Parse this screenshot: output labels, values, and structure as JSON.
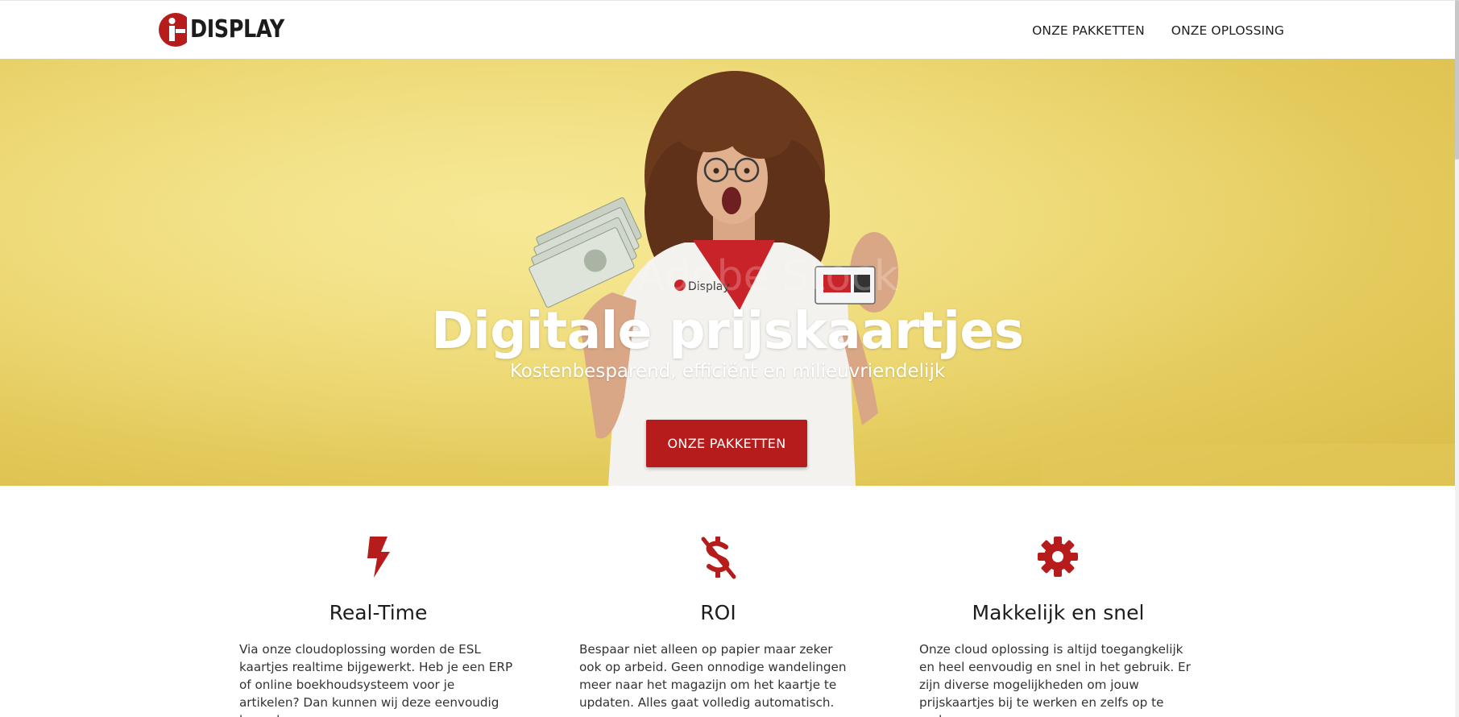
{
  "header": {
    "logo_text": "DISPLAY",
    "logo_letter": "i",
    "nav": [
      {
        "label": "ONZE PAKKETTEN"
      },
      {
        "label": "ONZE OPLOSSING"
      }
    ]
  },
  "hero": {
    "title": "Digitale prijskaartjes",
    "subtitle": "Kostenbesparend, efficiënt en milieuvriendelijk",
    "button_label": "ONZE PAKKETTEN",
    "shirt_brand": "Display",
    "watermark": "Adobe Stock"
  },
  "features": [
    {
      "icon": "lightning-bolt-icon",
      "title": "Real-Time",
      "text": "Via onze cloudoplossing worden de ESL kaartjes realtime bijgewerkt. Heb je een ERP of online boekhoudsysteem voor je artikelen? Dan kunnen wij deze eenvoudig koppelen."
    },
    {
      "icon": "no-dollar-icon",
      "title": "ROI",
      "text": "Bespaar niet alleen op papier maar zeker ook op arbeid. Geen onnodige wandelingen meer naar het magazijn om het kaartje te updaten. Alles gaat volledig automatisch."
    },
    {
      "icon": "gear-icon",
      "title": "Makkelijk en snel",
      "text": "Onze cloud oplossing is altijd toegangkelijk en heel eenvoudig en snel in het gebruik. Er zijn diverse mogelijkheden om jouw prijskaartjes bij te werken en zelfs op te maken."
    }
  ],
  "colors": {
    "accent": "#b71c1c",
    "hero_yellow": "#e8cf63",
    "text": "#222222"
  }
}
